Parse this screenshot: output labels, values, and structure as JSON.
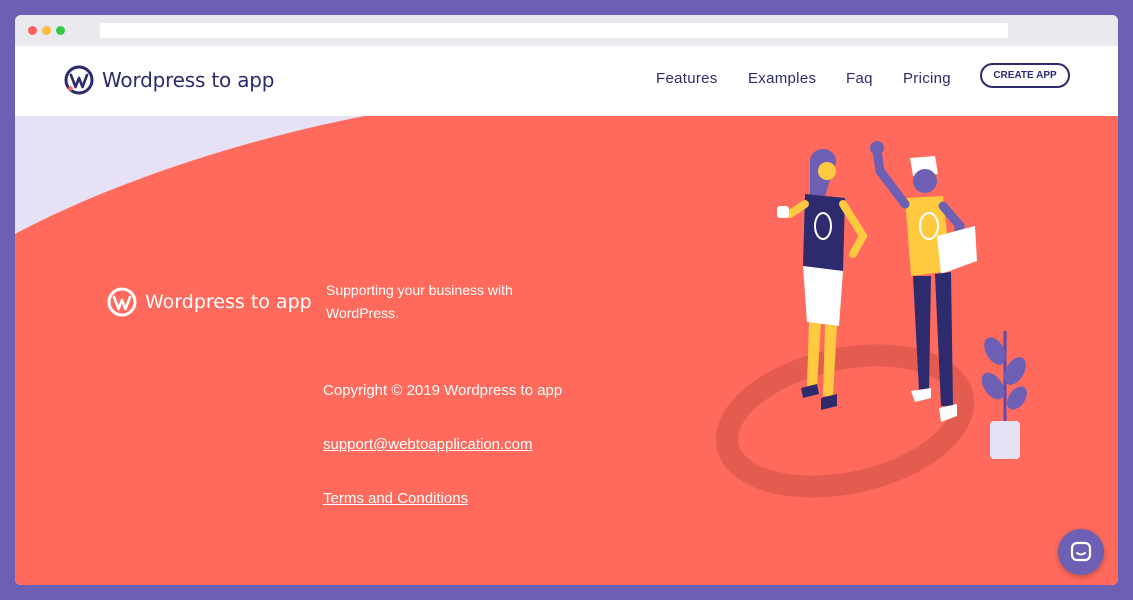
{
  "brand": {
    "name": "Wordpress to app",
    "accent": "#2d2a6e",
    "coral": "#ff6a5c",
    "purple": "#6d5fb3",
    "logo_icon": "wordpress-logo-icon"
  },
  "nav": {
    "items": [
      {
        "label": "Features"
      },
      {
        "label": "Examples"
      },
      {
        "label": "Faq"
      },
      {
        "label": "Pricing"
      }
    ],
    "cta_label": "CREATE APP"
  },
  "footer": {
    "tagline": "Supporting your business with WordPress.",
    "copyright": "Copyright © 2019 Wordpress to app",
    "support_email": "support@webtoapplication.com",
    "terms_label": "Terms and Conditions"
  },
  "chat": {
    "icon": "chat-icon"
  }
}
